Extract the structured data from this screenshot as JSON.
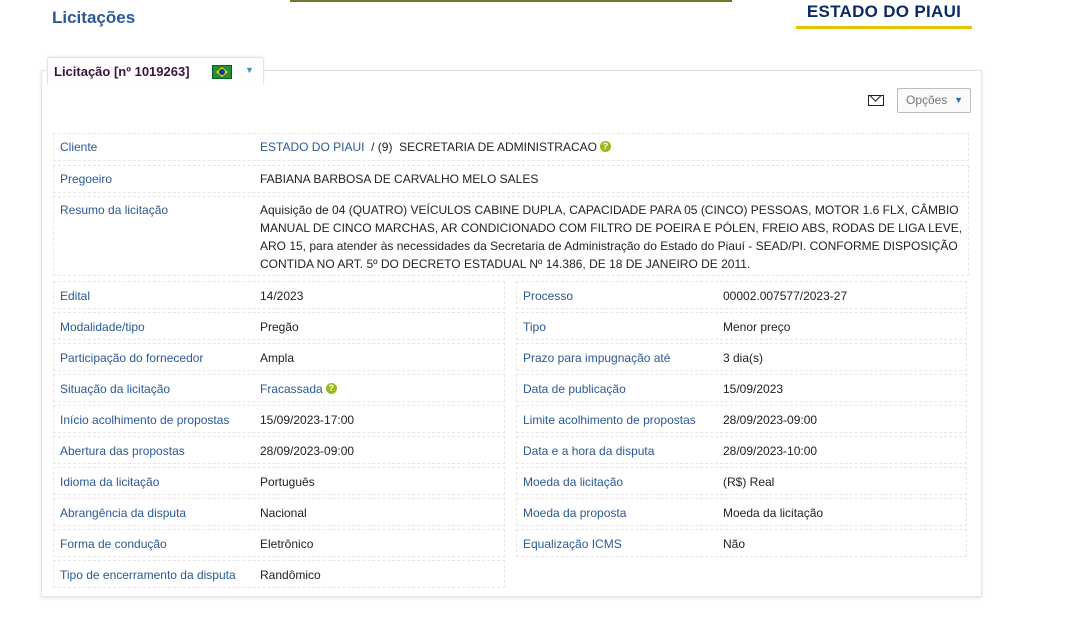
{
  "page": {
    "title": "Licitações",
    "brand": "ESTADO DO PIAUI"
  },
  "tab": {
    "label": "Licitação [nº 1019263]"
  },
  "toolbar": {
    "options_label": "Opções"
  },
  "client": {
    "label": "Cliente",
    "org": "ESTADO DO PIAUI",
    "sep": "/ (9)",
    "dept": "SECRETARIA DE ADMINISTRACAO"
  },
  "pregoeiro": {
    "label": "Pregoeiro",
    "value": "FABIANA BARBOSA DE CARVALHO MELO SALES"
  },
  "resumo": {
    "label": "Resumo da licitação",
    "lines": [
      "Aquisição de 04 (QUATRO) VEÍCULOS CABINE DUPLA, CAPACIDADE PARA 05 (CINCO) PESSOAS, MOTOR 1.6 FLX, CÂMBIO",
      "MANUAL DE CINCO MARCHAS, AR CONDICIONADO COM FILTRO DE POEIRA E PÓLEN, FREIO ABS, RODAS DE LIGA LEVE,",
      "ARO 15, para atender às necessidades da Secretaria de Administração do Estado do Piauí - SEAD/PI. CONFORME DISPOSIÇÃO",
      "CONTIDA NO ART. 5º DO DECRETO ESTADUAL Nº 14.386, DE 18 DE JANEIRO DE 2011."
    ]
  },
  "left": [
    {
      "label": "Edital",
      "value": "14/2023"
    },
    {
      "label": "Modalidade/tipo",
      "value": "Pregão"
    },
    {
      "label": "Participação do fornecedor",
      "value": "Ampla"
    },
    {
      "label": "Situação da licitação",
      "value": "Fracassada"
    },
    {
      "label": "Início acolhimento de propostas",
      "value": "15/09/2023-17:00"
    },
    {
      "label": "Abertura das propostas",
      "value": "28/09/2023-09:00"
    },
    {
      "label": "Idioma da licitação",
      "value": "Português"
    },
    {
      "label": "Abrangência da disputa",
      "value": "Nacional"
    },
    {
      "label": "Forma de condução",
      "value": "Eletrônico"
    },
    {
      "label": "Tipo de encerramento da disputa",
      "value": "Randômico"
    }
  ],
  "right": [
    {
      "label": "Processo",
      "value": "00002.007577/2023-27"
    },
    {
      "label": "Tipo",
      "value": "Menor preço"
    },
    {
      "label": "Prazo para impugnação até",
      "value": "3 dia(s)"
    },
    {
      "label": "Data de publicação",
      "value": "15/09/2023"
    },
    {
      "label": "Limite acolhimento de propostas",
      "value": "28/09/2023-09:00"
    },
    {
      "label": "Data e a hora da disputa",
      "value": "28/09/2023-10:00"
    },
    {
      "label": "Moeda da licitação",
      "value": "(R$) Real"
    },
    {
      "label": "Moeda da proposta",
      "value": "Moeda da licitação"
    },
    {
      "label": "Equalização ICMS",
      "value": "Não"
    }
  ],
  "help_glyph": "?",
  "colors": {
    "label": "#2a5a95",
    "brand": "#0c2a6b",
    "brand_underline": "#e5c400",
    "help": "#9cb81e"
  }
}
